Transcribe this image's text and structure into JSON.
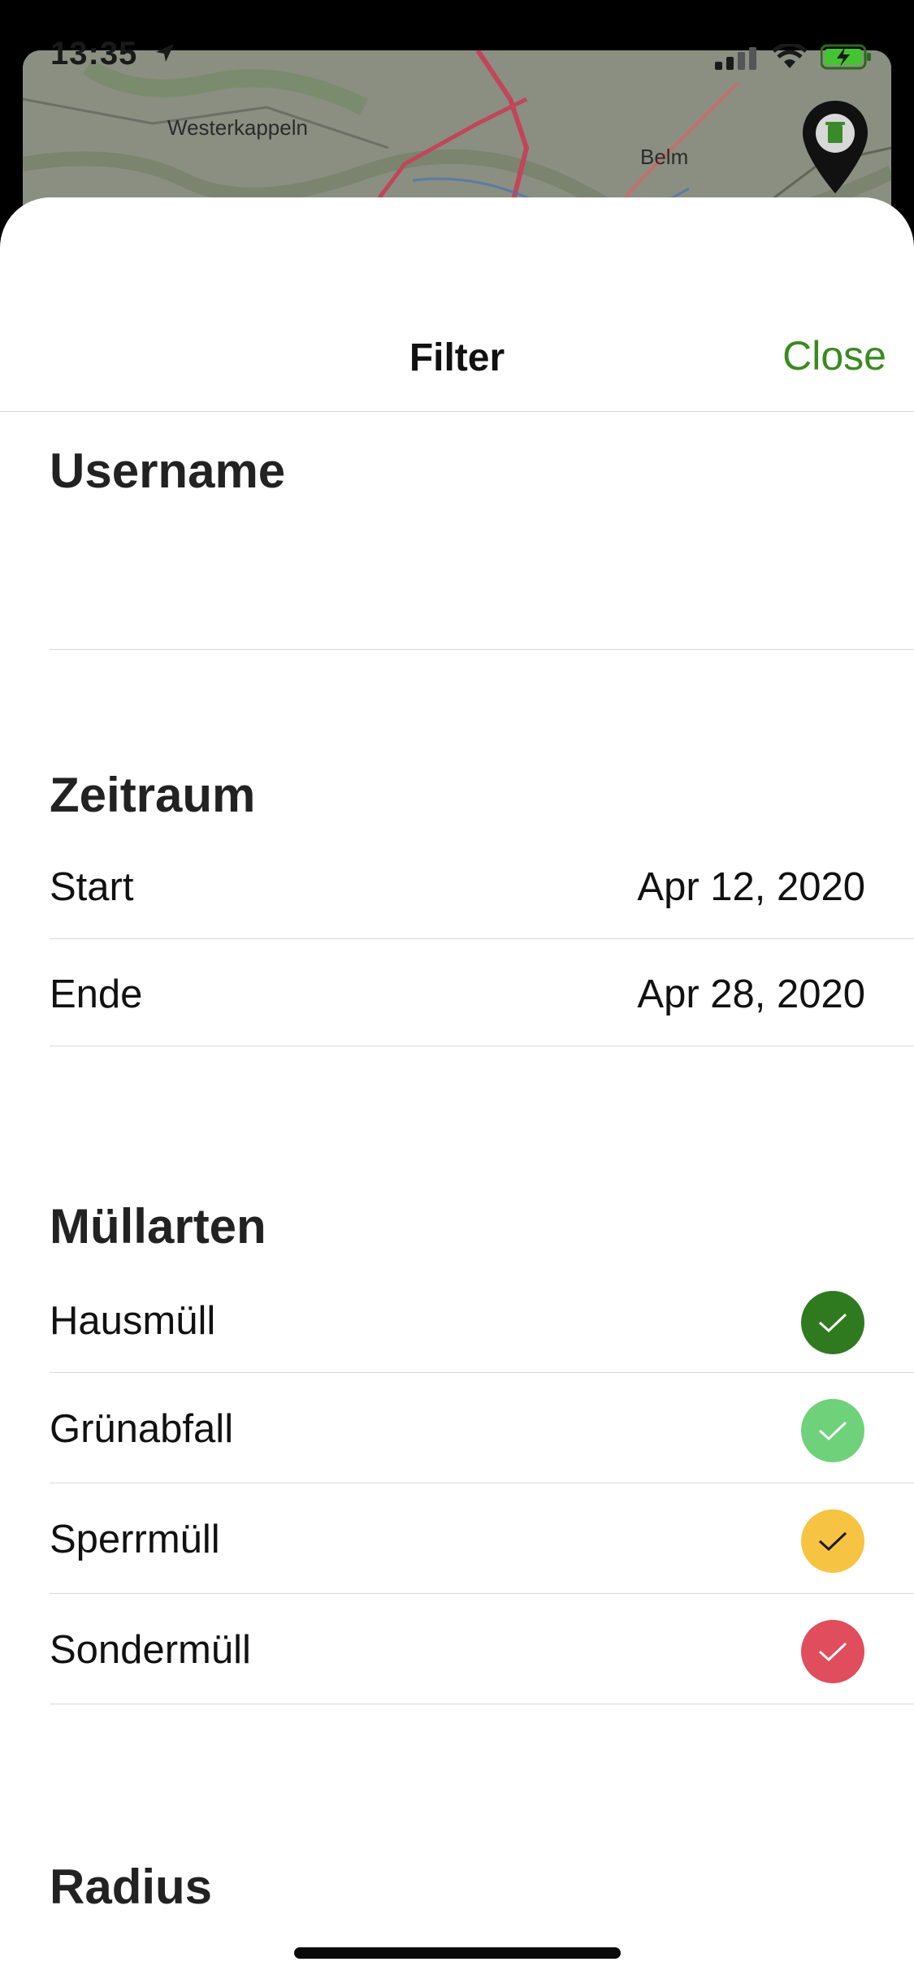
{
  "status_bar": {
    "time": "13:35"
  },
  "map": {
    "labels": {
      "westerkappeln": "Westerkappeln",
      "belm": "Belm"
    }
  },
  "nav": {
    "title": "Filter",
    "close_label": "Close",
    "accent": "#3a8a1f"
  },
  "sections": {
    "username": {
      "title": "Username",
      "value": ""
    },
    "zeitraum": {
      "title": "Zeitraum",
      "start_label": "Start",
      "start_value": "Apr 12, 2020",
      "end_label": "Ende",
      "end_value": "Apr 28, 2020"
    },
    "muellarten": {
      "title": "Müllarten",
      "items": [
        {
          "label": "Hausmüll",
          "color": "#2f7a1f",
          "check_color": "#ffffff",
          "checked": true
        },
        {
          "label": "Grünabfall",
          "color": "#6fd17a",
          "check_color": "#ffffff",
          "checked": true
        },
        {
          "label": "Sperrmüll",
          "color": "#f6c342",
          "check_color": "#1a1a1a",
          "checked": true
        },
        {
          "label": "Sondermüll",
          "color": "#e04d5c",
          "check_color": "#ffffff",
          "checked": true
        }
      ]
    },
    "radius": {
      "title": "Radius"
    }
  },
  "icons": {
    "status": [
      "location-arrow-icon",
      "cellular-signal-icon",
      "wifi-icon",
      "battery-charging-icon"
    ],
    "map": [
      "trash-pin-icon"
    ],
    "rows": [
      "checkmark-icon"
    ]
  }
}
